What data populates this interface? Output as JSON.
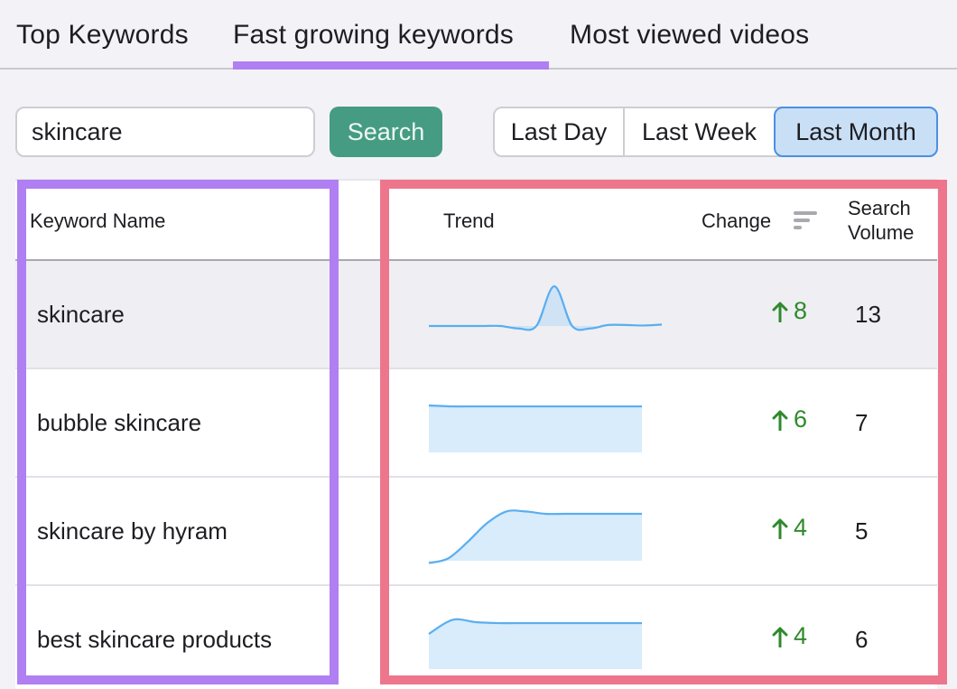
{
  "tabs": [
    {
      "label": "Top Keywords",
      "active": false
    },
    {
      "label": "Fast growing keywords",
      "active": true
    },
    {
      "label": "Most viewed videos",
      "active": false
    }
  ],
  "search": {
    "value": "skincare",
    "button_label": "Search"
  },
  "time_range": {
    "options": [
      "Last Day",
      "Last Week",
      "Last Month"
    ],
    "selected": "Last Month"
  },
  "table": {
    "columns": {
      "keyword": "Keyword Name",
      "trend": "Trend",
      "change": "Change",
      "volume": "Search Volume"
    },
    "sort_icon": "sort-descending-icon",
    "rows": [
      {
        "keyword": "skincare",
        "change": "8",
        "volume": "13",
        "trend": [
          0.1,
          0.1,
          0.1,
          0.1,
          0.1,
          0.05,
          0.1,
          0.9,
          0.1,
          0.05,
          0.12,
          0.12,
          0.11,
          0.13
        ],
        "highlighted": true
      },
      {
        "keyword": "bubble skincare",
        "change": "6",
        "volume": "7",
        "trend": [
          1,
          0.98,
          0.98,
          0.98,
          0.98,
          0.98,
          0.98,
          0.98,
          0.98,
          0.98
        ],
        "highlighted": false
      },
      {
        "keyword": "skincare by hyram",
        "change": "4",
        "volume": "5",
        "trend": [
          -0.05,
          0.05,
          0.4,
          0.8,
          1.05,
          1.05,
          1.0,
          1.0,
          1.0,
          1.0,
          1.0,
          1.0
        ],
        "highlighted": false
      },
      {
        "keyword": "best skincare products",
        "change": "4",
        "volume": "6",
        "trend": [
          0.75,
          1.05,
          1.0,
          0.98,
          0.98,
          0.98,
          0.98,
          0.98,
          0.98,
          0.98
        ],
        "highlighted": false
      }
    ]
  },
  "colors": {
    "tab_underline": "#b07ff2",
    "search_button": "#459c82",
    "selected_segment": "#c8dff5",
    "trend_line": "#5aaef0",
    "trend_fill": "#d8ecfb",
    "change_up": "#2e8a2c",
    "annotation_purple": "#b07ff2",
    "annotation_pink": "#ee768c"
  }
}
